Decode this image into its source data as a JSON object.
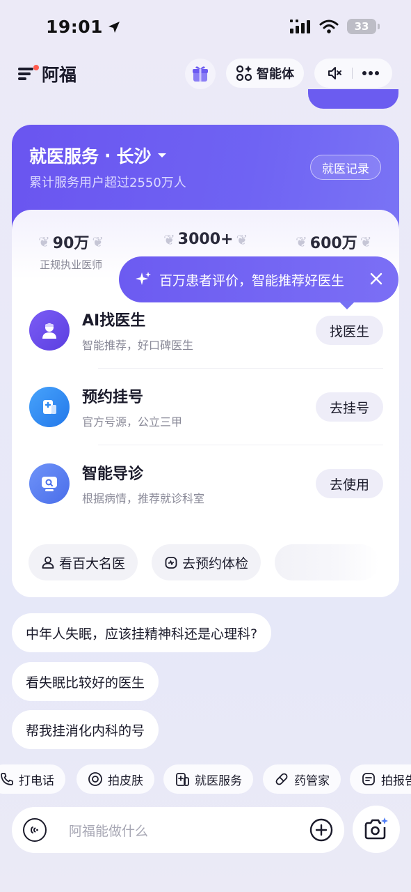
{
  "status": {
    "time": "19:01",
    "battery": "33"
  },
  "header": {
    "title": "阿福",
    "agent_label": "智能体"
  },
  "service": {
    "title": "就医服务",
    "separator": "·",
    "city": "长沙",
    "subtitle": "累计服务用户超过2550万人",
    "record_label": "就医记录",
    "stats": [
      {
        "value": "90万",
        "label": "正规执业医师"
      },
      {
        "value": "3000+",
        "label": ""
      },
      {
        "value": "600万",
        "label": ""
      }
    ],
    "tooltip": "百万患者评价，智能推荐好医生",
    "rows": [
      {
        "title": "AI找医生",
        "subtitle": "智能推荐，好口碑医生",
        "button": "找医生",
        "icon": "doctor-icon",
        "color": "#6c4ef0"
      },
      {
        "title": "预约挂号",
        "subtitle": "官方号源，公立三甲",
        "button": "去挂号",
        "icon": "hospital-icon",
        "color": "#2f8cf2"
      },
      {
        "title": "智能导诊",
        "subtitle": "根据病情，推荐就诊科室",
        "button": "去使用",
        "icon": "monitor-icon",
        "color": "#5b7ef2"
      }
    ],
    "chips": [
      {
        "label": "看百大名医",
        "icon": "person-icon"
      },
      {
        "label": "去预约体检",
        "icon": "checkup-icon"
      }
    ]
  },
  "suggestions": [
    "中年人失眠，应该挂精神科还是心理科?",
    "看失眠比较好的医生",
    "帮我挂消化内科的号"
  ],
  "tools": [
    {
      "label": "打电话",
      "icon": "phone-icon"
    },
    {
      "label": "拍皮肤",
      "icon": "camera-icon"
    },
    {
      "label": "就医服务",
      "icon": "medical-icon"
    },
    {
      "label": "药管家",
      "icon": "pill-icon"
    },
    {
      "label": "拍报告",
      "icon": "report-icon"
    }
  ],
  "input": {
    "placeholder": "阿福能做什么"
  },
  "colors": {
    "accent": "#6c5bf1",
    "accent_light": "#eeedf8"
  }
}
